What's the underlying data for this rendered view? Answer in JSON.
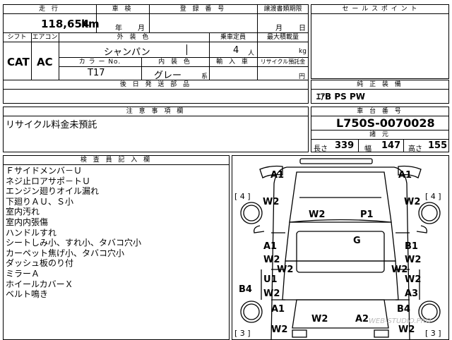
{
  "top_table": {
    "mileage_header": "走 行",
    "mileage_value": "118,654",
    "mileage_unit": "km",
    "inspection_header": "車 検",
    "inspection_year": "年",
    "inspection_month": "月",
    "reg_header": "登 録 番 号",
    "transfer_header": "譲渡書類期限",
    "transfer_month": "月",
    "transfer_day": "日",
    "shift_header": "シフト",
    "aircon_header": "エアコン",
    "exterior_color_header": "外 装 色",
    "capacity_header": "乗車定員",
    "load_header": "最大積載量",
    "shift_value": "CAT",
    "aircon_value": "AC",
    "exterior_color_value": "シャンパン",
    "capacity_value": "4",
    "capacity_unit": "人",
    "load_unit": "kg",
    "color_no_header": "カ ラ ー No.",
    "interior_color_header": "内 装 色",
    "import_header": "輸 入 車",
    "recycle_header": "リサイクル預託金",
    "color_no_value": "T17",
    "interior_color_value": "グレー",
    "interior_color_suffix": "系",
    "recycle_unit": "円",
    "parts_header": "後 日 発 送 部 品"
  },
  "sales_point": {
    "header": "セ ー ル ス ポ イ ン ト"
  },
  "equipment": {
    "header": "純 正 装 備",
    "value": "ｴｱB PS PW"
  },
  "notes": {
    "header": "注 意 事 項 欄",
    "value": "リサイクル料金未預託"
  },
  "chassis": {
    "header": "車 台 番 号",
    "value": "L750S-0070028",
    "dims_header": "諸 元",
    "length_label": "長さ",
    "length_value": "339",
    "width_label": "幅",
    "width_value": "147",
    "height_label": "高さ",
    "height_value": "155"
  },
  "inspector": {
    "header": "検 査 員 記 入 欄",
    "lines": [
      "Ｆサイドメンバ－Ｕ",
      "ネジ止ロアサポ－トＵ",
      "エンジン廻りオイル漏れ",
      "下廻りＡＵ、Ｓ小",
      "室内汚れ",
      "室内内張傷",
      "ハンドルすれ",
      "シートしみ小、すれ小、タバコ穴小",
      "カーペット焦げ小、タバコ穴小",
      "ダッシュ板のり付",
      "ミラーＡ",
      "ホイールカバーＸ",
      "ベルト鳴き"
    ]
  },
  "diagram": {
    "tire_fl": "[ 4 ]",
    "tire_fr": "[ 4 ]",
    "tire_rl": "[ 3 ]",
    "tire_rr": "[ 3 ]",
    "front_left": "A1",
    "front_right": "A1",
    "fender_left": "W2",
    "fender_right": "W2",
    "hood_left": "W2",
    "hood_right": "P1",
    "roof": "G",
    "left_door1_a": "A1",
    "left_door1_b": "W2",
    "left_sill_1": "W2",
    "left_door2_a": "U1",
    "left_door2_b": "W2",
    "right_door1_a": "B1",
    "right_door1_b": "W2",
    "right_sill_1": "W2",
    "right_door2_a": "W2",
    "right_door2_b": "A3",
    "left_b4": "B4",
    "right_b4": "B4",
    "rear_left_a": "A1",
    "rear_left_b": "W2",
    "right_rear_b": "W2",
    "back_left": "W2",
    "back_right": "A2",
    "watermark": "WEB-STUDIO.PRO"
  }
}
